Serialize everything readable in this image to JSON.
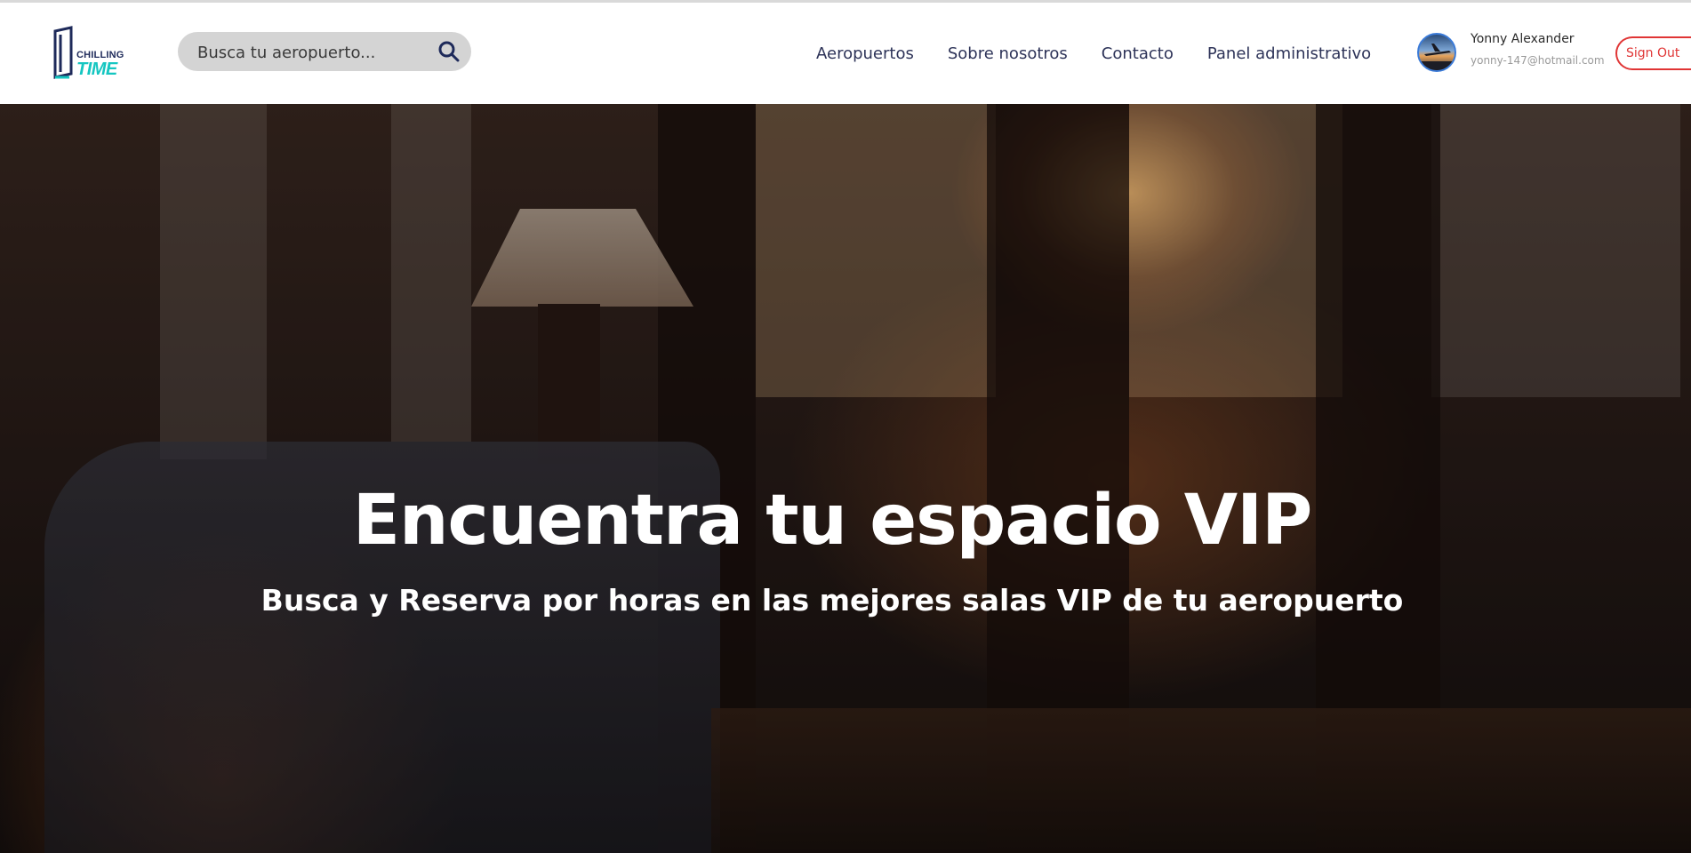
{
  "header": {
    "logo": {
      "line1": "CHILLING",
      "line2": "TIME"
    },
    "search": {
      "placeholder": "Busca tu aeropuerto..."
    },
    "nav": [
      {
        "label": "Aeropuertos"
      },
      {
        "label": "Sobre nosotros"
      },
      {
        "label": "Contacto"
      },
      {
        "label": "Panel administrativo"
      }
    ],
    "user": {
      "name": "Yonny Alexander",
      "email": "yonny-147@hotmail.com"
    },
    "signout_label": "Sign Out"
  },
  "hero": {
    "title": "Encuentra tu espacio VIP",
    "subtitle": "Busca y Reserva por horas en las mejores salas VIP de tu aeropuerto"
  },
  "icons": {
    "search": "search-icon",
    "logo": "chilling-time-logo"
  },
  "colors": {
    "brand_navy": "#1e2a5a",
    "brand_teal": "#15c6c1",
    "signout_red": "#e03535",
    "search_bg": "#d4d4d4"
  }
}
